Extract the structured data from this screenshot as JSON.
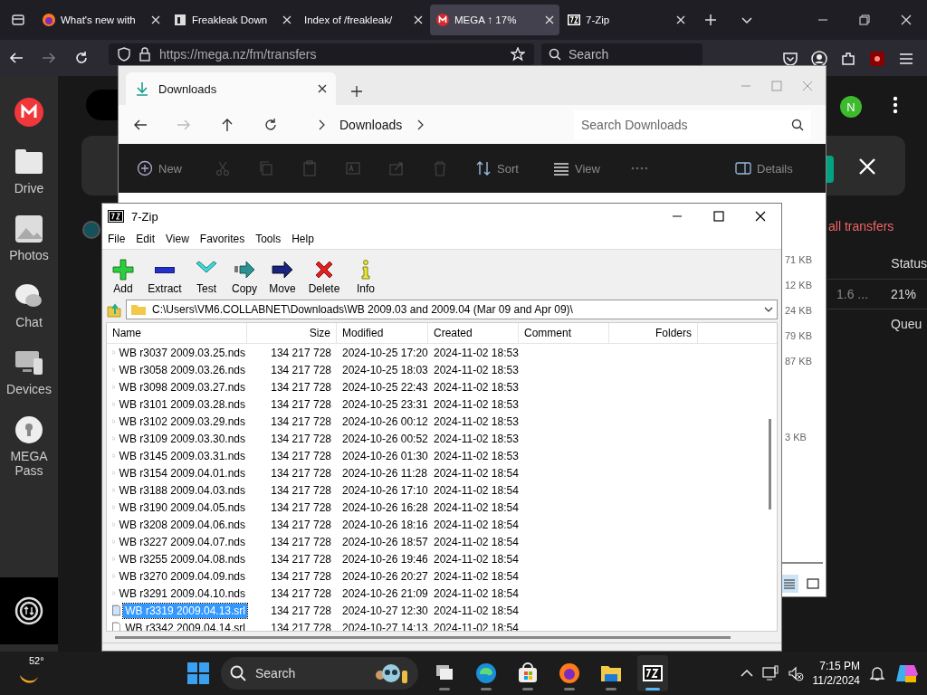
{
  "browser": {
    "tabs": [
      {
        "title": "What's new with",
        "kind": "firefox",
        "selected": false
      },
      {
        "title": "Freakleak Down",
        "kind": "letter",
        "selected": false
      },
      {
        "title": "Index of /freakleak/",
        "selected": false
      },
      {
        "title": "MEGA ↑ 17%",
        "kind": "mega",
        "selected": true
      },
      {
        "title": "7-Zip",
        "kind": "sevenzip",
        "selected": false
      }
    ],
    "address": "https://mega.nz/fm/transfers",
    "search_placeholder": "Search"
  },
  "mega": {
    "nav": [
      {
        "label": "Drive",
        "kind": "drive"
      },
      {
        "label": "Photos",
        "kind": "photos"
      },
      {
        "label": "Chat",
        "kind": "chat"
      },
      {
        "label": "Devices",
        "kind": "devices"
      },
      {
        "label": "MEGA Pass",
        "kind": "pass"
      }
    ],
    "avatar": "N",
    "all_transfers": "all transfers",
    "status_header": "Status",
    "transfers": [
      {
        "column_1": "1.6 ...",
        "status": "21%"
      },
      {
        "status": "Queu"
      }
    ]
  },
  "downloads_window": {
    "tab": "Downloads",
    "breadcrumb": "Downloads",
    "search_placeholder": "Search Downloads",
    "toolbar": [
      {
        "kind": "new",
        "label": "New"
      },
      {
        "kind": "cut"
      },
      {
        "kind": "copy"
      },
      {
        "kind": "paste"
      },
      {
        "kind": "rename"
      },
      {
        "kind": "share"
      },
      {
        "kind": "delete"
      },
      {
        "kind": "sort",
        "label": "Sort"
      },
      {
        "kind": "view",
        "label": "View"
      },
      {
        "kind": "more"
      },
      {
        "kind": "details",
        "label": "Details"
      }
    ],
    "sizes": [
      "71 KB",
      "12 KB",
      "24 KB",
      "79 KB",
      "87 KB",
      "3 KB"
    ]
  },
  "sevenzip": {
    "title": "7-Zip",
    "menu": [
      "File",
      "Edit",
      "View",
      "Favorites",
      "Tools",
      "Help"
    ],
    "toolbar": [
      {
        "kind": "add",
        "label": "Add"
      },
      {
        "kind": "extract",
        "label": "Extract"
      },
      {
        "kind": "test",
        "label": "Test"
      },
      {
        "kind": "copy",
        "label": "Copy"
      },
      {
        "kind": "move",
        "label": "Move"
      },
      {
        "kind": "delete",
        "label": "Delete"
      },
      {
        "kind": "info",
        "label": "Info"
      }
    ],
    "path": "C:\\Users\\VM6.COLLABNET\\Downloads\\WB 2009.03 and 2009.04 (Mar 09 and Apr 09)\\",
    "columns": [
      "Name",
      "Size",
      "Modified",
      "Created",
      "Comment",
      "Folders"
    ],
    "rows": [
      {
        "name": "WB r3037 2009.03.25.nds",
        "size": "134 217 728",
        "modified": "2024-10-25 17:20",
        "created": "2024-11-02 18:53",
        "selected": false
      },
      {
        "name": "WB r3058 2009.03.26.nds",
        "size": "134 217 728",
        "modified": "2024-10-25 18:03",
        "created": "2024-11-02 18:53",
        "selected": false
      },
      {
        "name": "WB r3098 2009.03.27.nds",
        "size": "134 217 728",
        "modified": "2024-10-25 22:43",
        "created": "2024-11-02 18:53",
        "selected": false
      },
      {
        "name": "WB r3101 2009.03.28.nds",
        "size": "134 217 728",
        "modified": "2024-10-25 23:31",
        "created": "2024-11-02 18:53",
        "selected": false
      },
      {
        "name": "WB r3102 2009.03.29.nds",
        "size": "134 217 728",
        "modified": "2024-10-26 00:12",
        "created": "2024-11-02 18:53",
        "selected": false
      },
      {
        "name": "WB r3109 2009.03.30.nds",
        "size": "134 217 728",
        "modified": "2024-10-26 00:52",
        "created": "2024-11-02 18:53",
        "selected": false
      },
      {
        "name": "WB r3145 2009.03.31.nds",
        "size": "134 217 728",
        "modified": "2024-10-26 01:30",
        "created": "2024-11-02 18:53",
        "selected": false
      },
      {
        "name": "WB r3154 2009.04.01.nds",
        "size": "134 217 728",
        "modified": "2024-10-26 11:28",
        "created": "2024-11-02 18:54",
        "selected": false
      },
      {
        "name": "WB r3188 2009.04.03.nds",
        "size": "134 217 728",
        "modified": "2024-10-26 17:10",
        "created": "2024-11-02 18:54",
        "selected": false
      },
      {
        "name": "WB r3190 2009.04.05.nds",
        "size": "134 217 728",
        "modified": "2024-10-26 16:28",
        "created": "2024-11-02 18:54",
        "selected": false
      },
      {
        "name": "WB r3208 2009.04.06.nds",
        "size": "134 217 728",
        "modified": "2024-10-26 18:16",
        "created": "2024-11-02 18:54",
        "selected": false
      },
      {
        "name": "WB r3227 2009.04.07.nds",
        "size": "134 217 728",
        "modified": "2024-10-26 18:57",
        "created": "2024-11-02 18:54",
        "selected": false
      },
      {
        "name": "WB r3255 2009.04.08.nds",
        "size": "134 217 728",
        "modified": "2024-10-26 19:46",
        "created": "2024-11-02 18:54",
        "selected": false
      },
      {
        "name": "WB r3270 2009.04.09.nds",
        "size": "134 217 728",
        "modified": "2024-10-26 20:27",
        "created": "2024-11-02 18:54",
        "selected": false
      },
      {
        "name": "WB r3291 2009.04.10.nds",
        "size": "134 217 728",
        "modified": "2024-10-26 21:09",
        "created": "2024-11-02 18:54",
        "selected": false
      },
      {
        "name": "WB r3319 2009.04.13.srl",
        "size": "134 217 728",
        "modified": "2024-10-27 12:30",
        "created": "2024-11-02 18:54",
        "selected": true
      },
      {
        "name": "WB r3342 2009.04.14.srl",
        "size": "134 217 728",
        "modified": "2024-10-27 14:13",
        "created": "2024-11-02 18:54",
        "selected": false
      }
    ]
  },
  "taskbar": {
    "weather": "52°",
    "search_placeholder": "Search",
    "time": "7:15 PM",
    "date": "11/2/2024",
    "apps": [
      {
        "kind": "taskview",
        "active": false
      },
      {
        "kind": "edge",
        "active": false
      },
      {
        "kind": "store",
        "active": false
      },
      {
        "kind": "firefox",
        "active": false
      },
      {
        "kind": "explorer",
        "active": false
      },
      {
        "kind": "sevenzip",
        "active": true
      }
    ]
  }
}
